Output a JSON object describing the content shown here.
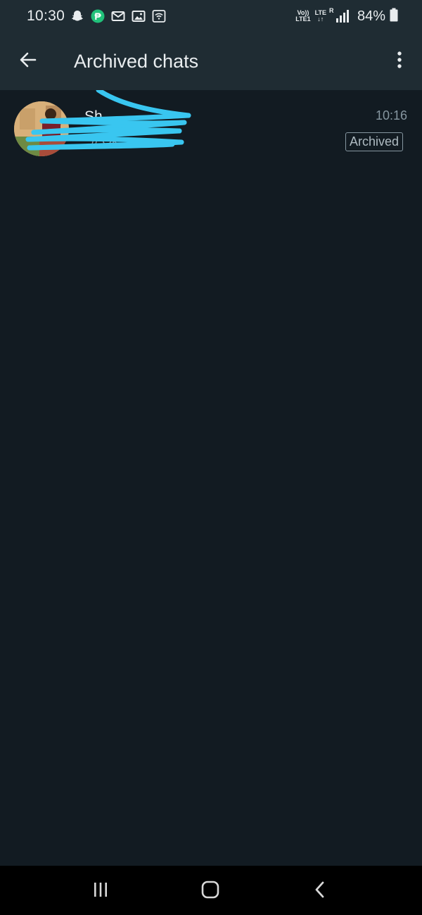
{
  "status_bar": {
    "time": "10:30",
    "left_icons": [
      "snapchat-icon",
      "paytm-icon",
      "gmail-icon",
      "gallery-icon",
      "wifi-call-icon"
    ],
    "net_top": "Vo))",
    "net_bottom": "LTE1",
    "lte_label": "LTE",
    "roaming_label": "R",
    "battery_percent": "84%"
  },
  "app_bar": {
    "title": "Archived chats",
    "back_icon": "back-arrow-icon",
    "menu_icon": "more-vert-icon"
  },
  "chats": [
    {
      "name": "Sh...",
      "preview": "// Ok",
      "time": "10:16",
      "badge": "Archived"
    }
  ],
  "colors": {
    "background": "#121b22",
    "app_bar": "#1f2c33",
    "primary_text": "#e9edef",
    "secondary_text": "#8696a0",
    "redaction_scribble": "#39c6f0"
  },
  "nav_bar": {
    "icons": [
      "recent-apps-icon",
      "home-icon",
      "back-icon"
    ]
  }
}
